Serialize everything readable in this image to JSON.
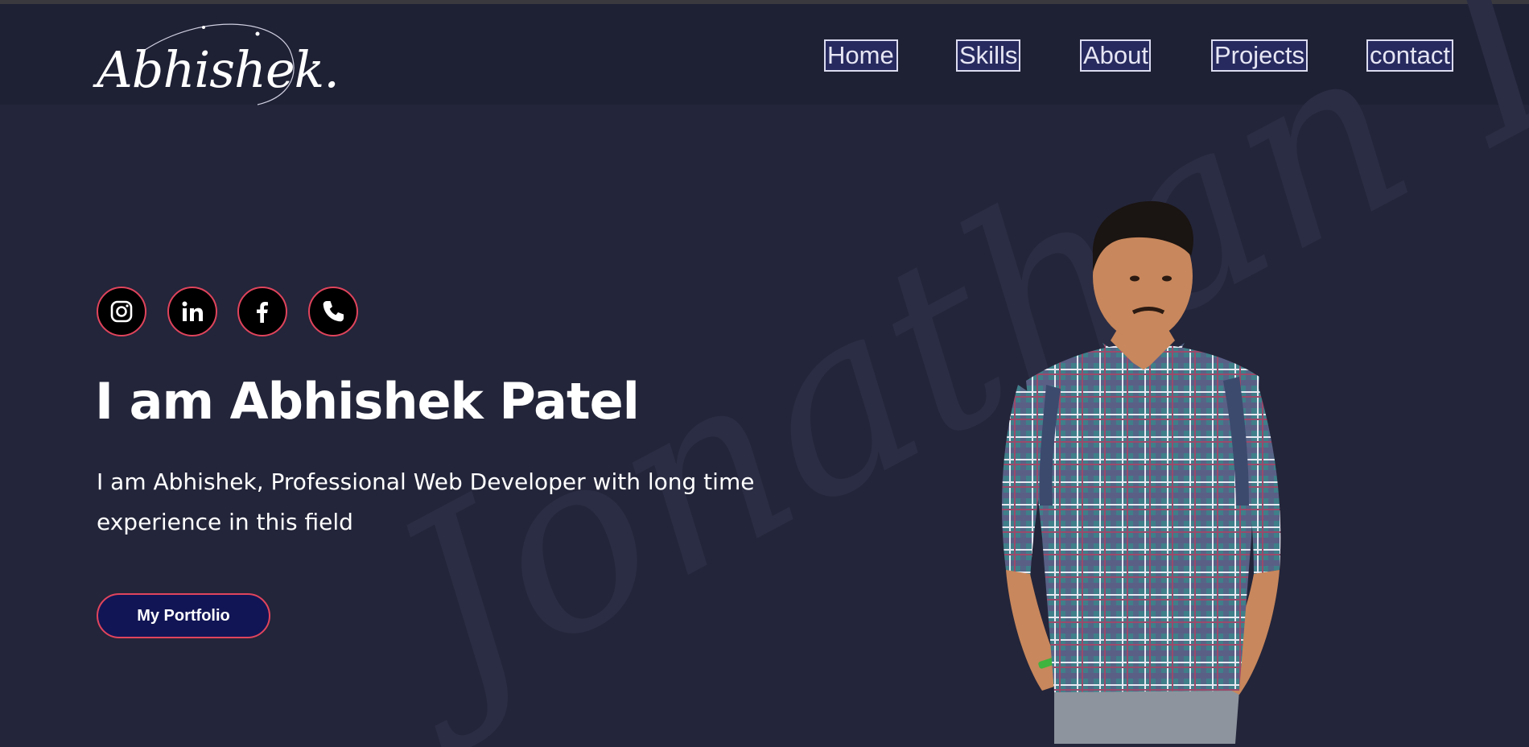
{
  "header": {
    "logo_text": "Abhishek.",
    "nav": [
      {
        "label": "Home"
      },
      {
        "label": "Skills"
      },
      {
        "label": "About"
      },
      {
        "label": "Projects"
      },
      {
        "label": "contact"
      }
    ]
  },
  "background": {
    "watermark_text": "Jonathan D"
  },
  "hero": {
    "socials": [
      {
        "icon": "instagram-icon"
      },
      {
        "icon": "linkedin-icon"
      },
      {
        "icon": "facebook-icon"
      },
      {
        "icon": "phone-icon"
      }
    ],
    "title": "I am Abhishek Patel",
    "subtitle": "I am Abhishek, Professional Web Developer with long time experience in this field",
    "cta_label": "My Portfolio"
  },
  "colors": {
    "page_bg": "#23253a",
    "header_bg": "#1e2034",
    "accent": "#e0445c",
    "button_bg": "#111555",
    "nav_bg": "#272a5e"
  }
}
